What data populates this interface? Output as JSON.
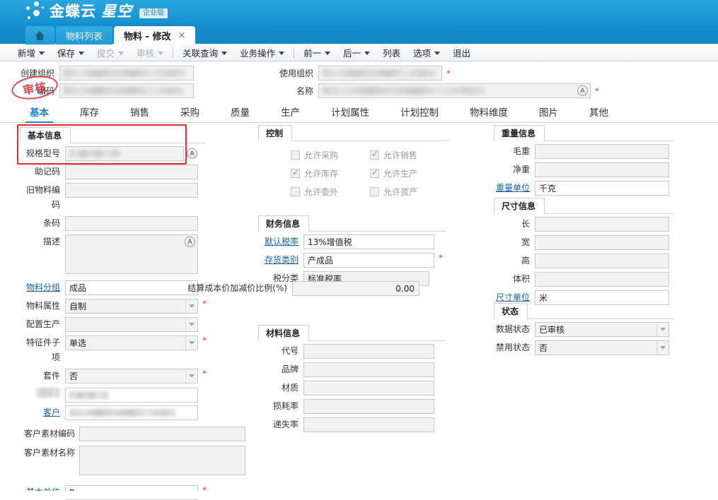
{
  "header": {
    "brand_main": "金蝶云",
    "brand_sub": "星空",
    "badge": "企业版"
  },
  "browser_tabs": {
    "home_icon": "home-icon",
    "items": [
      {
        "label": "物料列表",
        "active": false,
        "closable": false
      },
      {
        "label": "物料 - 修改",
        "active": true,
        "closable": true,
        "close_glyph": "×"
      }
    ]
  },
  "toolbar": {
    "items": [
      {
        "label": "新增",
        "caret": true,
        "disabled": false
      },
      {
        "label": "保存",
        "caret": true,
        "disabled": false
      },
      {
        "label": "提交",
        "caret": true,
        "disabled": true
      },
      {
        "label": "审核",
        "caret": true,
        "disabled": true
      },
      {
        "sep": true
      },
      {
        "label": "关联查询",
        "caret": true,
        "disabled": false
      },
      {
        "label": "业务操作",
        "caret": true,
        "disabled": false
      },
      {
        "sep": true
      },
      {
        "label": "前一",
        "caret": true,
        "disabled": false
      },
      {
        "label": "后一",
        "caret": true,
        "disabled": false
      },
      {
        "label": "列表",
        "caret": false,
        "disabled": false
      },
      {
        "label": "选项",
        "caret": true,
        "disabled": false
      },
      {
        "label": "退出",
        "caret": false,
        "disabled": false
      }
    ]
  },
  "stamp": {
    "text": "审核"
  },
  "top_form": {
    "create_org": {
      "label": "创建组织",
      "value": "",
      "masked": true
    },
    "number": {
      "label": "编码",
      "value": "",
      "masked": true
    },
    "use_org": {
      "label": "使用组织",
      "value": "",
      "masked": true,
      "required": true,
      "required_mark": "*"
    },
    "name": {
      "label": "名称",
      "value": "",
      "masked": true,
      "required": true,
      "required_mark": "*",
      "assist_icon": "A"
    }
  },
  "main_tabs": [
    {
      "label": "基本",
      "active": true
    },
    {
      "label": "库存",
      "active": false
    },
    {
      "label": "销售",
      "active": false
    },
    {
      "label": "采购",
      "active": false
    },
    {
      "label": "质量",
      "active": false
    },
    {
      "label": "生产",
      "active": false
    },
    {
      "label": "计划属性",
      "active": false
    },
    {
      "label": "计划控制",
      "active": false
    },
    {
      "label": "物料维度",
      "active": false
    },
    {
      "label": "图片",
      "active": false
    },
    {
      "label": "其他",
      "active": false
    }
  ],
  "groups": {
    "basic_info": {
      "title": "基本信息",
      "fields": {
        "spec": {
          "label": "规格型号",
          "value": "",
          "masked": true,
          "assist_icon": "A"
        },
        "mnemonic": {
          "label": "助记码",
          "value": ""
        },
        "old_code": {
          "label": "旧物料编码",
          "value": ""
        },
        "barcode": {
          "label": "条码",
          "value": ""
        },
        "description": {
          "label": "描述",
          "value": "",
          "assist_icon": "A"
        },
        "material_group": {
          "label": "物料分组",
          "value": "成品",
          "link": true
        },
        "material_property": {
          "label": "物料属性",
          "value": "自制",
          "dropdown": true,
          "required_mark": "*"
        },
        "config_production": {
          "label": "配置生产",
          "value": "",
          "dropdown": true
        },
        "feature_sub": {
          "label": "特征件子项",
          "value": "单选",
          "dropdown": true,
          "required_mark": "*"
        },
        "kit": {
          "label": "套件",
          "value": "否",
          "dropdown": true,
          "required_mark": "*"
        },
        "masked_field": {
          "label": "",
          "value": "",
          "masked": true
        },
        "customer": {
          "label": "客户",
          "value": "",
          "masked": true,
          "link": true
        },
        "cust_mat_code": {
          "label": "客户素材编码",
          "value": ""
        },
        "cust_mat_name": {
          "label": "客户素材名称",
          "value": ""
        },
        "base_unit": {
          "label": "基本单位",
          "value": "Pcs",
          "link": true,
          "required_mark": "*"
        }
      }
    },
    "control": {
      "title": "控制",
      "checkboxes": [
        {
          "label": "允许采购",
          "checked": false
        },
        {
          "label": "允许销售",
          "checked": true
        },
        {
          "label": "允许库存",
          "checked": true
        },
        {
          "label": "允许生产",
          "checked": true
        },
        {
          "label": "允许委外",
          "checked": false
        },
        {
          "label": "允许资产",
          "checked": false
        }
      ]
    },
    "finance_info": {
      "title": "财务信息",
      "fields": {
        "default_tax": {
          "label": "默认税率",
          "value": "13%增值税",
          "link": true
        },
        "inventory_type": {
          "label": "存货类别",
          "value": "产成品",
          "link": true,
          "required_mark": "*"
        },
        "tax_category": {
          "label": "税分类",
          "value": "标准税率"
        },
        "cost_ratio": {
          "label": "结算成本价加减价比例(%)",
          "value": "0.00"
        }
      }
    },
    "material_info": {
      "title": "材料信息",
      "fields": {
        "code_no": {
          "label": "代号",
          "value": ""
        },
        "brand": {
          "label": "品牌",
          "value": ""
        },
        "texture": {
          "label": "材质",
          "value": ""
        },
        "loss_rate": {
          "label": "损耗率",
          "value": ""
        },
        "miss_rate": {
          "label": "递失率",
          "value": ""
        }
      }
    },
    "weight_info": {
      "title": "重量信息",
      "fields": {
        "gross_weight": {
          "label": "毛重",
          "value": ""
        },
        "net_weight": {
          "label": "净重",
          "value": ""
        },
        "weight_unit": {
          "label": "重量单位",
          "value": "千克",
          "link": true
        }
      }
    },
    "size_info": {
      "title": "尺寸信息",
      "fields": {
        "length": {
          "label": "长",
          "value": ""
        },
        "width": {
          "label": "宽",
          "value": ""
        },
        "height": {
          "label": "高",
          "value": ""
        },
        "volume": {
          "label": "体积",
          "value": ""
        },
        "size_unit": {
          "label": "尺寸单位",
          "value": "米",
          "link": true
        }
      }
    },
    "status": {
      "title": "状态",
      "fields": {
        "data_status": {
          "label": "数据状态",
          "value": "已审核",
          "dropdown": true
        },
        "forbid_status": {
          "label": "禁用状态",
          "value": "否",
          "dropdown": true
        }
      }
    }
  },
  "colors": {
    "header_blue": "#1b9bd8",
    "accent_blue": "#1b86c8",
    "link_blue": "#1763a6",
    "required_red": "#e33",
    "annotation_red": "#e8282b",
    "stamp_red": "#d2232a"
  }
}
